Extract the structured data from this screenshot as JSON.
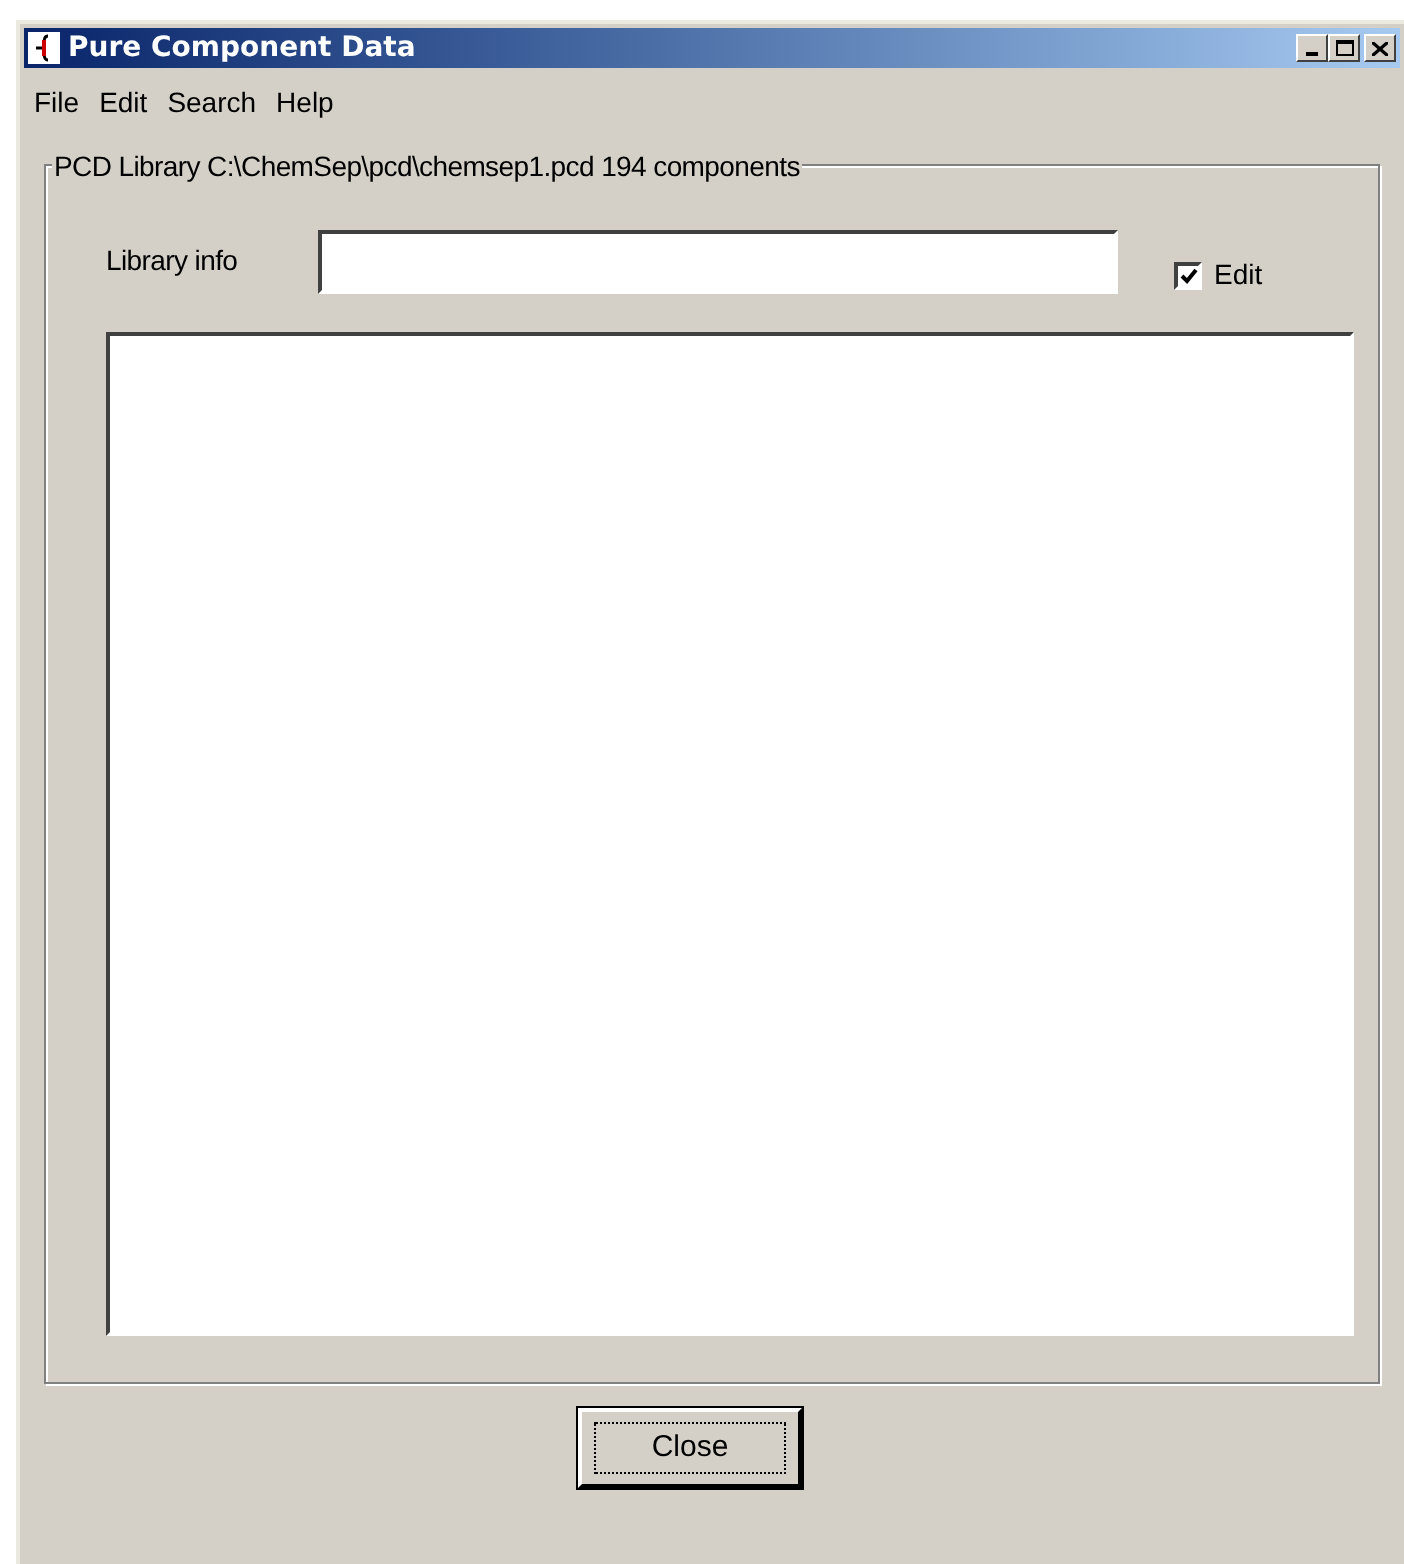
{
  "window": {
    "title": "Pure Component Data"
  },
  "menu": [
    "File",
    "Edit",
    "Search",
    "Help"
  ],
  "group": {
    "title": "PCD Library C:\\ChemSep\\pcd\\chemsep1.pcd 194 components"
  },
  "library_info": {
    "label": "Library info"
  },
  "edit_checkbox": {
    "label": "Edit",
    "checked": true
  },
  "buttons": [
    "Close"
  ]
}
